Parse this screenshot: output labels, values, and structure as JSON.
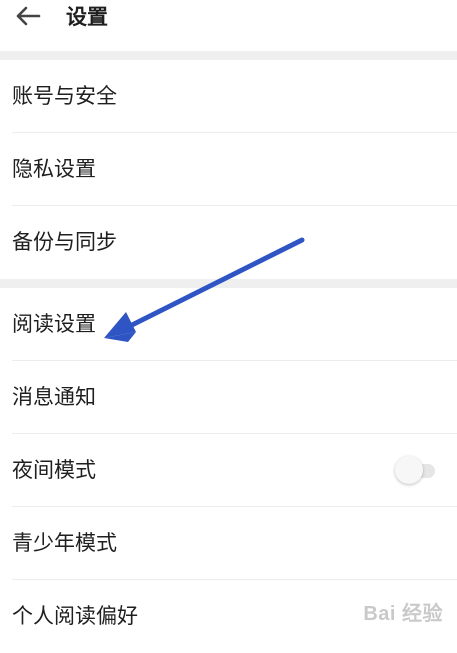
{
  "header": {
    "back_icon": "arrow-left-icon",
    "title": "设置"
  },
  "group1": {
    "items": [
      {
        "label": "账号与安全"
      },
      {
        "label": "隐私设置"
      },
      {
        "label": "备份与同步"
      }
    ]
  },
  "group2": {
    "items": [
      {
        "label": "阅读设置"
      },
      {
        "label": "消息通知"
      },
      {
        "label": "夜间模式",
        "toggle": false
      },
      {
        "label": "青少年模式"
      },
      {
        "label": "个人阅读偏好"
      }
    ]
  },
  "annotation": {
    "arrow_color": "#2f54c4",
    "points_to": "阅读设置"
  },
  "watermark": {
    "text": "Bai 经验"
  }
}
